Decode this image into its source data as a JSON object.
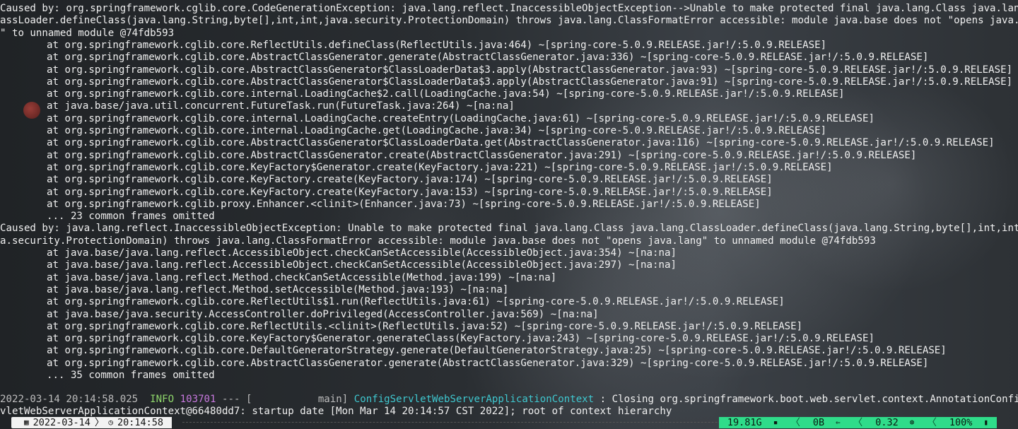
{
  "terminal": {
    "lines": [
      "Caused by: org.springframework.cglib.core.CodeGenerationException: java.lang.reflect.InaccessibleObjectException-->Unable to make protected final java.lang.Class java.lang.Cl",
      "assLoader.defineClass(java.lang.String,byte[],int,int,java.security.ProtectionDomain) throws java.lang.ClassFormatError accessible: module java.base does not \"opens java.lang",
      "\" to unnamed module @74fdb593",
      "at org.springframework.cglib.core.ReflectUtils.defineClass(ReflectUtils.java:464) ~[spring-core-5.0.9.RELEASE.jar!/:5.0.9.RELEASE]",
      "at org.springframework.cglib.core.AbstractClassGenerator.generate(AbstractClassGenerator.java:336) ~[spring-core-5.0.9.RELEASE.jar!/:5.0.9.RELEASE]",
      "at org.springframework.cglib.core.AbstractClassGenerator$ClassLoaderData$3.apply(AbstractClassGenerator.java:93) ~[spring-core-5.0.9.RELEASE.jar!/:5.0.9.RELEASE]",
      "at org.springframework.cglib.core.AbstractClassGenerator$ClassLoaderData$3.apply(AbstractClassGenerator.java:91) ~[spring-core-5.0.9.RELEASE.jar!/:5.0.9.RELEASE]",
      "at org.springframework.cglib.core.internal.LoadingCache$2.call(LoadingCache.java:54) ~[spring-core-5.0.9.RELEASE.jar!/:5.0.9.RELEASE]",
      "at java.base/java.util.concurrent.FutureTask.run(FutureTask.java:264) ~[na:na]",
      "at org.springframework.cglib.core.internal.LoadingCache.createEntry(LoadingCache.java:61) ~[spring-core-5.0.9.RELEASE.jar!/:5.0.9.RELEASE]",
      "at org.springframework.cglib.core.internal.LoadingCache.get(LoadingCache.java:34) ~[spring-core-5.0.9.RELEASE.jar!/:5.0.9.RELEASE]",
      "at org.springframework.cglib.core.AbstractClassGenerator$ClassLoaderData.get(AbstractClassGenerator.java:116) ~[spring-core-5.0.9.RELEASE.jar!/:5.0.9.RELEASE]",
      "at org.springframework.cglib.core.AbstractClassGenerator.create(AbstractClassGenerator.java:291) ~[spring-core-5.0.9.RELEASE.jar!/:5.0.9.RELEASE]",
      "at org.springframework.cglib.core.KeyFactory$Generator.create(KeyFactory.java:221) ~[spring-core-5.0.9.RELEASE.jar!/:5.0.9.RELEASE]",
      "at org.springframework.cglib.core.KeyFactory.create(KeyFactory.java:174) ~[spring-core-5.0.9.RELEASE.jar!/:5.0.9.RELEASE]",
      "at org.springframework.cglib.core.KeyFactory.create(KeyFactory.java:153) ~[spring-core-5.0.9.RELEASE.jar!/:5.0.9.RELEASE]",
      "at org.springframework.cglib.proxy.Enhancer.<clinit>(Enhancer.java:73) ~[spring-core-5.0.9.RELEASE.jar!/:5.0.9.RELEASE]",
      "... 23 common frames omitted",
      "Caused by: java.lang.reflect.InaccessibleObjectException: Unable to make protected final java.lang.Class java.lang.ClassLoader.defineClass(java.lang.String,byte[],int,int,ja",
      "a.security.ProtectionDomain) throws java.lang.ClassFormatError accessible: module java.base does not \"opens java.lang\" to unnamed module @74fdb593",
      "at java.base/java.lang.reflect.AccessibleObject.checkCanSetAccessible(AccessibleObject.java:354) ~[na:na]",
      "at java.base/java.lang.reflect.AccessibleObject.checkCanSetAccessible(AccessibleObject.java:297) ~[na:na]",
      "at java.base/java.lang.reflect.Method.checkCanSetAccessible(Method.java:199) ~[na:na]",
      "at java.base/java.lang.reflect.Method.setAccessible(Method.java:193) ~[na:na]",
      "at org.springframework.cglib.core.ReflectUtils$1.run(ReflectUtils.java:61) ~[spring-core-5.0.9.RELEASE.jar!/:5.0.9.RELEASE]",
      "at java.base/java.security.AccessController.doPrivileged(AccessController.java:569) ~[na:na]",
      "at org.springframework.cglib.core.ReflectUtils.<clinit>(ReflectUtils.java:52) ~[spring-core-5.0.9.RELEASE.jar!/:5.0.9.RELEASE]",
      "at org.springframework.cglib.core.KeyFactory$Generator.generateClass(KeyFactory.java:243) ~[spring-core-5.0.9.RELEASE.jar!/:5.0.9.RELEASE]",
      "at org.springframework.cglib.core.DefaultGeneratorStrategy.generate(DefaultGeneratorStrategy.java:25) ~[spring-core-5.0.9.RELEASE.jar!/:5.0.9.RELEASE]",
      "at org.springframework.cglib.core.AbstractClassGenerator.generate(AbstractClassGenerator.java:329) ~[spring-core-5.0.9.RELEASE.jar!/:5.0.9.RELEASE]",
      "... 35 common frames omitted"
    ],
    "log_entry": {
      "timestamp": "2022-03-14 20:14:58.025",
      "level": "INFO",
      "pid": "103701",
      "sep": "---",
      "thread": "[           main]",
      "logger": "ConfigServletWebServerApplicationContext",
      "message_part1": " : Closing org.springframework.boot.web.servlet.context.AnnotationConfigSer",
      "message_part2": "vletWebServerApplicationContext@66480dd7: startup date [Mon Mar 14 20:14:57 CST 2022]; root of context hierarchy"
    }
  },
  "statusbar": {
    "date": "2022-03-14",
    "time": "20:14:58",
    "memory": "19.81G",
    "network": "0B",
    "load": "0.32",
    "battery": "100%",
    "icons": {
      "date": "calendar-icon",
      "time": "clock-icon",
      "memory": "memory-icon",
      "network": "download-arrow-icon",
      "load": "cpu-icon",
      "battery": "battery-icon"
    },
    "colors": {
      "accent": "#2fdc8a",
      "info": "#8fd66b",
      "pid": "#c678dd",
      "logger": "#3fc7cf"
    }
  }
}
